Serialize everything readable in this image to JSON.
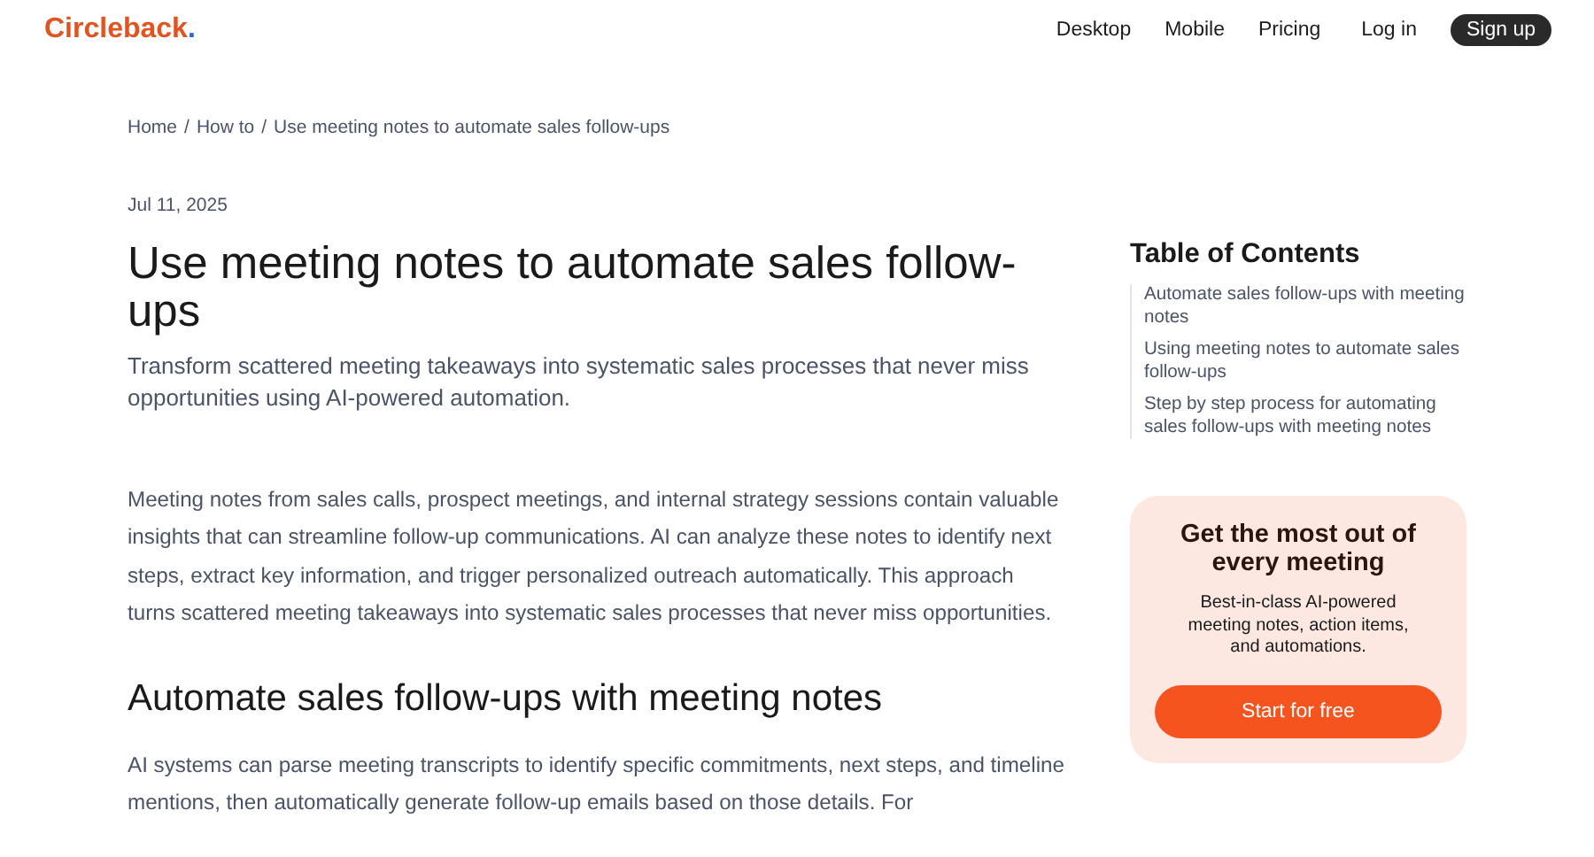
{
  "header": {
    "logo": "Circleback",
    "logo_dot": ".",
    "nav": [
      "Desktop",
      "Mobile",
      "Pricing"
    ],
    "login": "Log in",
    "signup": "Sign up"
  },
  "breadcrumb": {
    "separator": "/",
    "items": [
      "Home",
      "How to",
      "Use meeting notes to automate sales follow-ups"
    ]
  },
  "article": {
    "date": "Jul 11, 2025",
    "title": "Use meeting notes to automate sales follow-ups",
    "subtitle": "Transform scattered meeting takeaways into systematic sales processes that never miss opportunities using AI-powered automation.",
    "blocks": [
      {
        "kind": "paragraph",
        "text": "Meeting notes from sales calls, prospect meetings, and internal strategy sessions contain valuable insights that can streamline follow-up communications. AI can analyze these notes to identify next steps, extract key information, and trigger personalized outreach automatically. This approach turns scattered meeting takeaways into systematic sales processes that never miss opportunities."
      },
      {
        "kind": "heading",
        "text": "Automate sales follow-ups with meeting notes"
      },
      {
        "kind": "paragraph",
        "text": "AI systems can parse meeting transcripts to identify specific commitments, next steps, and timeline mentions, then automatically generate follow-up emails based on those details. For"
      }
    ]
  },
  "toc": {
    "title": "Table of Contents",
    "items": [
      "Automate sales follow-ups with meeting notes",
      "Using meeting notes to automate sales follow-ups",
      "Step by step process for automating sales follow-ups with meeting notes"
    ]
  },
  "promo": {
    "title": "Get the most out of every meeting",
    "text": "Best-in-class AI-powered meeting notes, action items, and automations.",
    "button": "Start for free"
  }
}
